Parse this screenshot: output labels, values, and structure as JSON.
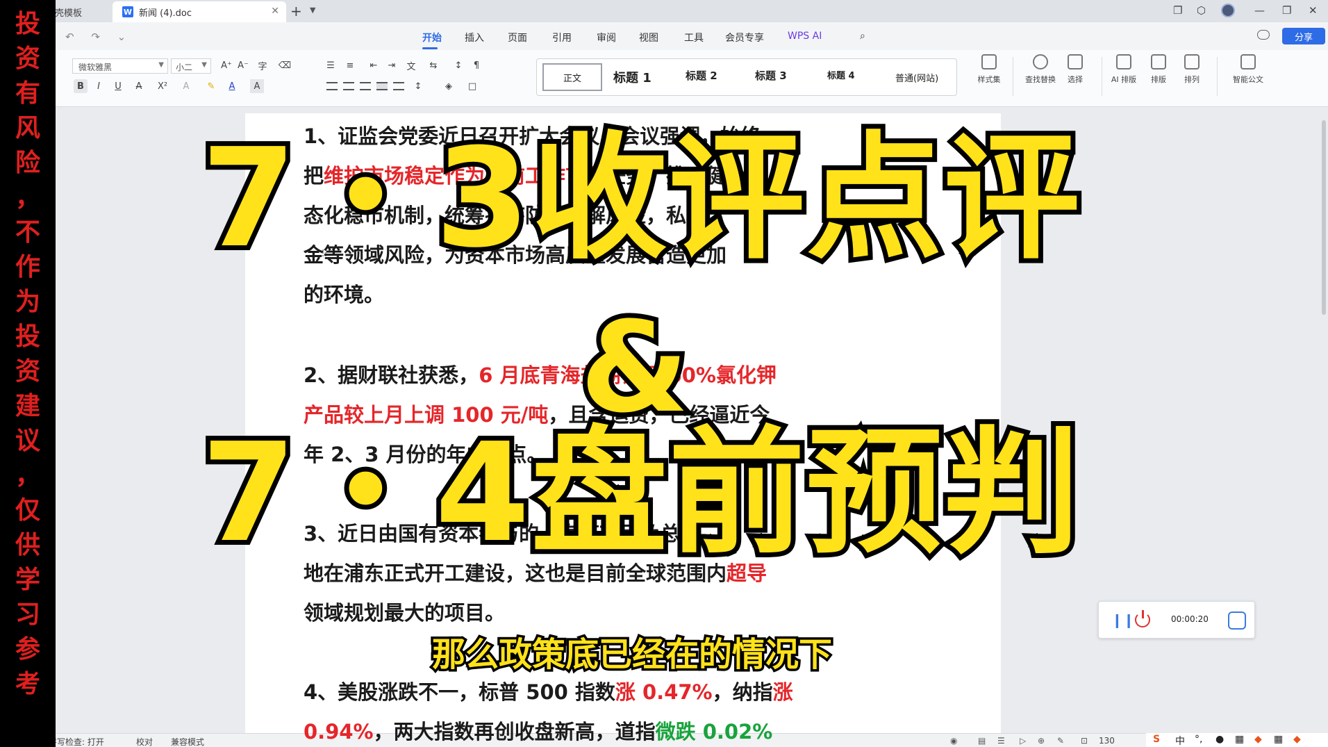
{
  "warning_chars": [
    "投",
    "资",
    "有",
    "风",
    "险",
    "，",
    "不",
    "作",
    "为",
    "投",
    "资",
    "建",
    "议",
    "，",
    "仅",
    "供",
    "学",
    "习",
    "参",
    "考"
  ],
  "tabs": {
    "prev_label": "稻壳模板",
    "active_label": "新闻 (4).doc",
    "doc_icon": "W"
  },
  "menu": {
    "items": [
      "开始",
      "插入",
      "页面",
      "引用",
      "审阅",
      "视图",
      "工具",
      "会员专享",
      "WPS AI"
    ],
    "share": "分享"
  },
  "ribbon": {
    "font": "微软雅黑",
    "size": "小二",
    "styles": [
      "正文",
      "标题 1",
      "标题 2",
      "标题 3",
      "标题 4",
      "普通(网站)"
    ],
    "tools": [
      "样式集",
      "查找替换",
      "选择",
      "AI 排版",
      "排版",
      "排列",
      "智能公文"
    ]
  },
  "document": {
    "p1": [
      [
        {
          "t": "1、证监会党委近日召开扩大会议，会议强调，始终",
          "c": ""
        }
      ],
      [
        {
          "t": "把",
          "c": ""
        },
        {
          "t": "维护市场稳定作为当前工作首要",
          "c": "red"
        },
        {
          "t": "任务，推动健全常",
          "c": ""
        }
      ],
      [
        {
          "t": "态化稳市机制，统筹排序防范化解风险，私募",
          "c": ""
        }
      ],
      [
        {
          "t": "金等领域风险，为资本市场高质量发展营造更加",
          "c": ""
        }
      ],
      [
        {
          "t": "的环境。",
          "c": ""
        }
      ]
    ],
    "p2": [
      [
        {
          "t": "2、据财联社获悉，",
          "c": ""
        },
        {
          "t": "6 月底青海盐湖钾肥 60%氯化钾",
          "c": "red"
        }
      ],
      [
        {
          "t": "产品较上月上调 100 元/吨",
          "c": "red"
        },
        {
          "t": "，且含运费，已经逼近今",
          "c": ""
        }
      ],
      [
        {
          "t": "年 2、3 月份的年内高点。",
          "c": ""
        }
      ]
    ],
    "p3": [
      [
        {
          "t": "3、近日由国有资本参与的上海某项目及总部",
          "c": ""
        }
      ],
      [
        {
          "t": "地在浦东正式开工建设，这也是目前全球范围内",
          "c": ""
        },
        {
          "t": "超导",
          "c": "red"
        }
      ],
      [
        {
          "t": "领域规划最大的项目。",
          "c": ""
        }
      ]
    ],
    "p4": [
      [
        {
          "t": "4、美股涨跌不一，标普 500 指数",
          "c": ""
        },
        {
          "t": "涨 0.47%",
          "c": "red"
        },
        {
          "t": "，纳指",
          "c": ""
        },
        {
          "t": "涨",
          "c": "red"
        }
      ],
      [
        {
          "t": "0.94%",
          "c": "red"
        },
        {
          "t": "，两大指数再创收盘新高，道指",
          "c": ""
        },
        {
          "t": "微跌 0.02%",
          "c": "green"
        }
      ]
    ]
  },
  "overlay": {
    "line1": "7・3收评点评",
    "amp": "&",
    "line2": "7・4盘前预判"
  },
  "subtitle": "那么政策底已经在的情况下",
  "recorder": {
    "time": "00:00:20"
  },
  "status": {
    "spellcheck": "拼写检查: 打开",
    "proof": "校对",
    "compat": "兼容模式",
    "zoom": "130"
  },
  "ime": [
    "中",
    "°,",
    "🎤",
    "⌨"
  ]
}
